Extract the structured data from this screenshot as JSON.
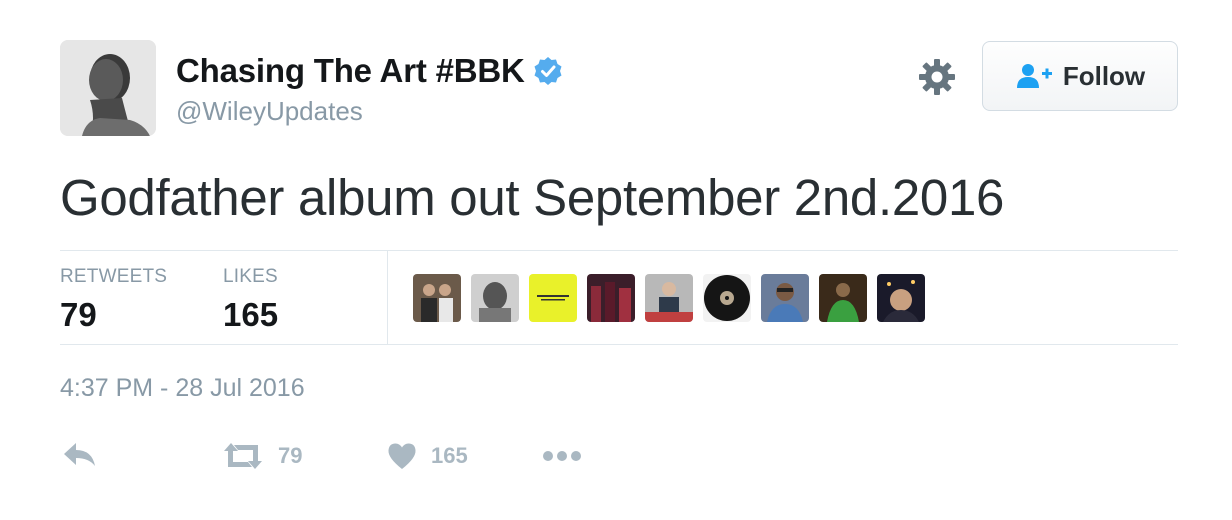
{
  "header": {
    "display_name": "Chasing The Art #BBK",
    "handle": "@WileyUpdates",
    "follow_label": "Follow"
  },
  "tweet": {
    "text": "Godfather album out September 2nd.2016",
    "timestamp": "4:37 PM - 28 Jul 2016"
  },
  "stats": {
    "retweets_label": "RETWEETS",
    "retweets_value": "79",
    "likes_label": "LIKES",
    "likes_value": "165"
  },
  "likers_count_shown": 9,
  "actions": {
    "retweet_count": "79",
    "like_count": "165"
  },
  "icons": {
    "verified": "verified-badge-icon",
    "settings": "gear-icon",
    "follow": "add-user-icon",
    "reply": "reply-icon",
    "retweet": "retweet-icon",
    "like": "heart-icon",
    "more": "more-dots-icon"
  },
  "colors": {
    "verified": "#55acee",
    "text_primary": "#14171a",
    "text_secondary": "#8899a6",
    "action_gray": "#aab8c2",
    "follow_icon": "#1da1f2",
    "divider": "#e1e8ed"
  }
}
